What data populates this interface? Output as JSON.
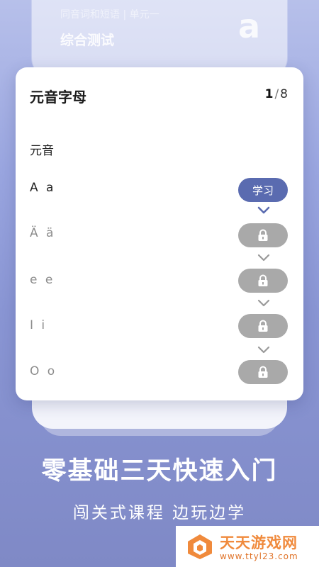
{
  "back_card": {
    "faded_text": "同音词和短语 | 单元一",
    "title": "综合测试",
    "letter": "a"
  },
  "card": {
    "title": "元音字母",
    "pager": {
      "current": "1",
      "separator": "/",
      "total": "8"
    },
    "section_label": "元音",
    "rows": [
      {
        "label": "A a",
        "action": "学习",
        "locked": false
      },
      {
        "label": "Ä ä",
        "locked": true
      },
      {
        "label": "e e",
        "locked": true
      },
      {
        "label": "I i",
        "locked": true
      },
      {
        "label": "O o",
        "locked": true
      }
    ]
  },
  "banner": {
    "headline": "零基础三天快速入门",
    "subline": "闯关式课程 边玩边学"
  },
  "watermark": {
    "name": "天天游戏网",
    "url": "www.ttyl23.com"
  },
  "colors": {
    "accent": "#5a6bb0",
    "locked": "#a9a9a9"
  }
}
